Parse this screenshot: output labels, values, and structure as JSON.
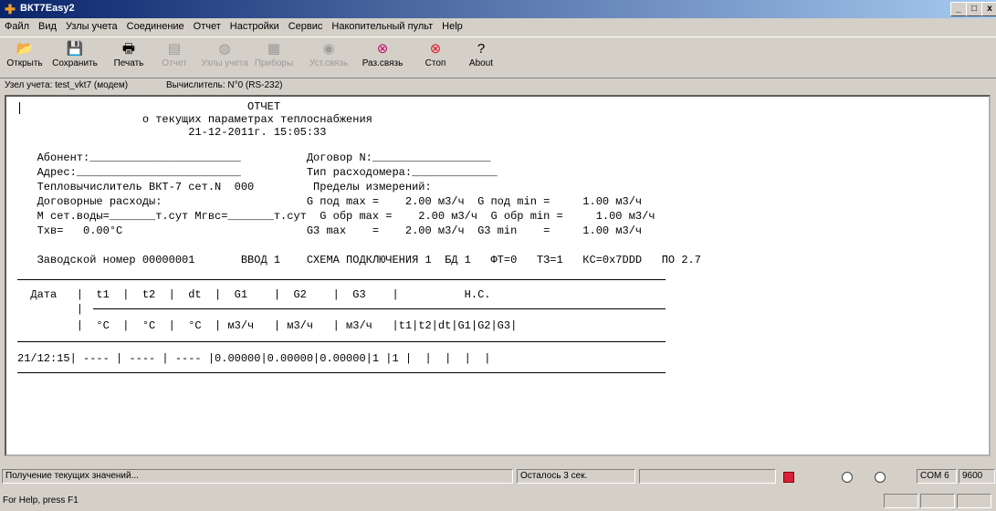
{
  "window": {
    "title": "ВКТ7Easy2",
    "controls": [
      "_",
      "□",
      "x"
    ]
  },
  "menu": [
    "Файл",
    "Вид",
    "Узлы учета",
    "Соединение",
    "Отчет",
    "Настройки",
    "Сервис",
    "Накопительный пульт",
    "Help"
  ],
  "toolbar": [
    {
      "label": "Открыть",
      "icon": "📂",
      "enabled": true
    },
    {
      "label": "Сохранить",
      "icon": "💾",
      "enabled": true
    },
    {
      "label": "Печать",
      "icon": "🖶",
      "enabled": true
    },
    {
      "label": "Отчет",
      "icon": "▤",
      "enabled": false
    },
    {
      "label": "Узлы учета",
      "icon": "◍",
      "enabled": false
    },
    {
      "label": "Приборы",
      "icon": "▦",
      "enabled": false
    },
    {
      "label": "Уст.связь",
      "icon": "◉",
      "enabled": false
    },
    {
      "label": "Раз.связь",
      "icon": "⊗",
      "enabled": true,
      "color": "#c0106c"
    },
    {
      "label": "Стоп",
      "icon": "⊗",
      "enabled": true,
      "color": "#d8202a"
    },
    {
      "label": "About",
      "icon": "?",
      "enabled": true
    }
  ],
  "info": {
    "node": "Узел учета: test_vkt7  (модем)",
    "calculator": "Вычислитель: N°0 (RS-232)"
  },
  "report": {
    "lines": [
      "                                   ОТЧЕТ",
      "                   о текущих параметрах теплоснабжения",
      "                          21-12-2011г. 15:05:33",
      "",
      "   Абонент:_______________________          Договор N:__________________",
      "   Адрес:_________________________          Тип расходомера:_____________",
      "   Тепловычислитель ВКТ-7 сет.N  000         Пределы измерений:",
      "   Договорные расходы:                      G под max =    2.00 м3/ч  G под min =     1.00 м3/ч",
      "   M сет.воды=_______т.сут Mгвс=_______т.сут  G обр max =    2.00 м3/ч  G обр min =     1.00 м3/ч",
      "   Tхв=   0.00°C                            G3 max    =    2.00 м3/ч  G3 min    =     1.00 м3/ч",
      "",
      "   Заводской номер 00000001       ВВОД 1    СХЕМА ПОДКЛЮЧЕНИЯ 1  БД 1   ФТ=0   ТЗ=1   КС=0x7DDD   ПО 2.7"
    ],
    "table_header": "  Дата   |  t1  |  t2  |  dt  |  G1    |  G2    |  G3    |          Н.С.",
    "table_sep": "         |",
    "table_units": "         |  °C  |  °C  |  °C  | м3/ч   | м3/ч   | м3/ч   |t1|t2|dt|G1|G2|G3|",
    "table_row": "21/12:15| ---- | ---- | ---- |0.00000|0.00000|0.00000|1 |1 |  |  |  |  |"
  },
  "status": {
    "message": "Получение текущих значений...",
    "remaining": "Осталось 3 сек.",
    "port": "COM 6",
    "baud": "9600"
  },
  "help": "For Help, press F1"
}
